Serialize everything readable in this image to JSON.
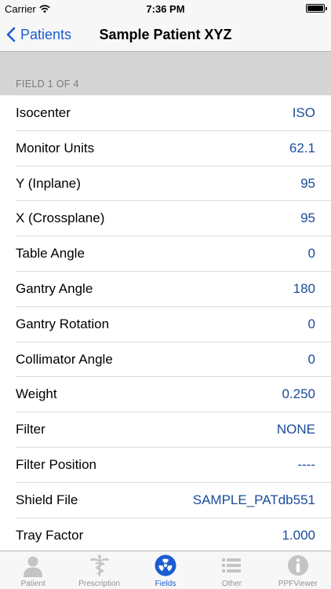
{
  "status": {
    "carrier": "Carrier",
    "time": "7:36 PM"
  },
  "nav": {
    "back_label": "Patients",
    "title": "Sample Patient XYZ"
  },
  "section": {
    "header": "FIELD 1 OF 4"
  },
  "rows": [
    {
      "label": "Isocenter",
      "value": "ISO"
    },
    {
      "label": "Monitor Units",
      "value": "62.1"
    },
    {
      "label": "Y (Inplane)",
      "value": "95"
    },
    {
      "label": "X (Crossplane)",
      "value": "95"
    },
    {
      "label": "Table Angle",
      "value": "0"
    },
    {
      "label": "Gantry Angle",
      "value": "180"
    },
    {
      "label": "Gantry Rotation",
      "value": "0"
    },
    {
      "label": "Collimator Angle",
      "value": "0"
    },
    {
      "label": "Weight",
      "value": "0.250"
    },
    {
      "label": "Filter",
      "value": "NONE"
    },
    {
      "label": "Filter Position",
      "value": "----"
    },
    {
      "label": "Shield File",
      "value": "SAMPLE_PATdb551"
    },
    {
      "label": "Tray Factor",
      "value": "1.000"
    }
  ],
  "tabs": [
    {
      "label": "Patient",
      "icon": "patient-icon",
      "active": false
    },
    {
      "label": "Prescription",
      "icon": "caduceus-icon",
      "active": false
    },
    {
      "label": "Fields",
      "icon": "radiation-icon",
      "active": true
    },
    {
      "label": "Other",
      "icon": "list-icon",
      "active": false
    },
    {
      "label": "PPFViewer",
      "icon": "info-icon",
      "active": false
    }
  ],
  "colors": {
    "accent": "#1a5dd0",
    "value_text": "#1a4b9c",
    "inactive_tab": "#929292"
  }
}
